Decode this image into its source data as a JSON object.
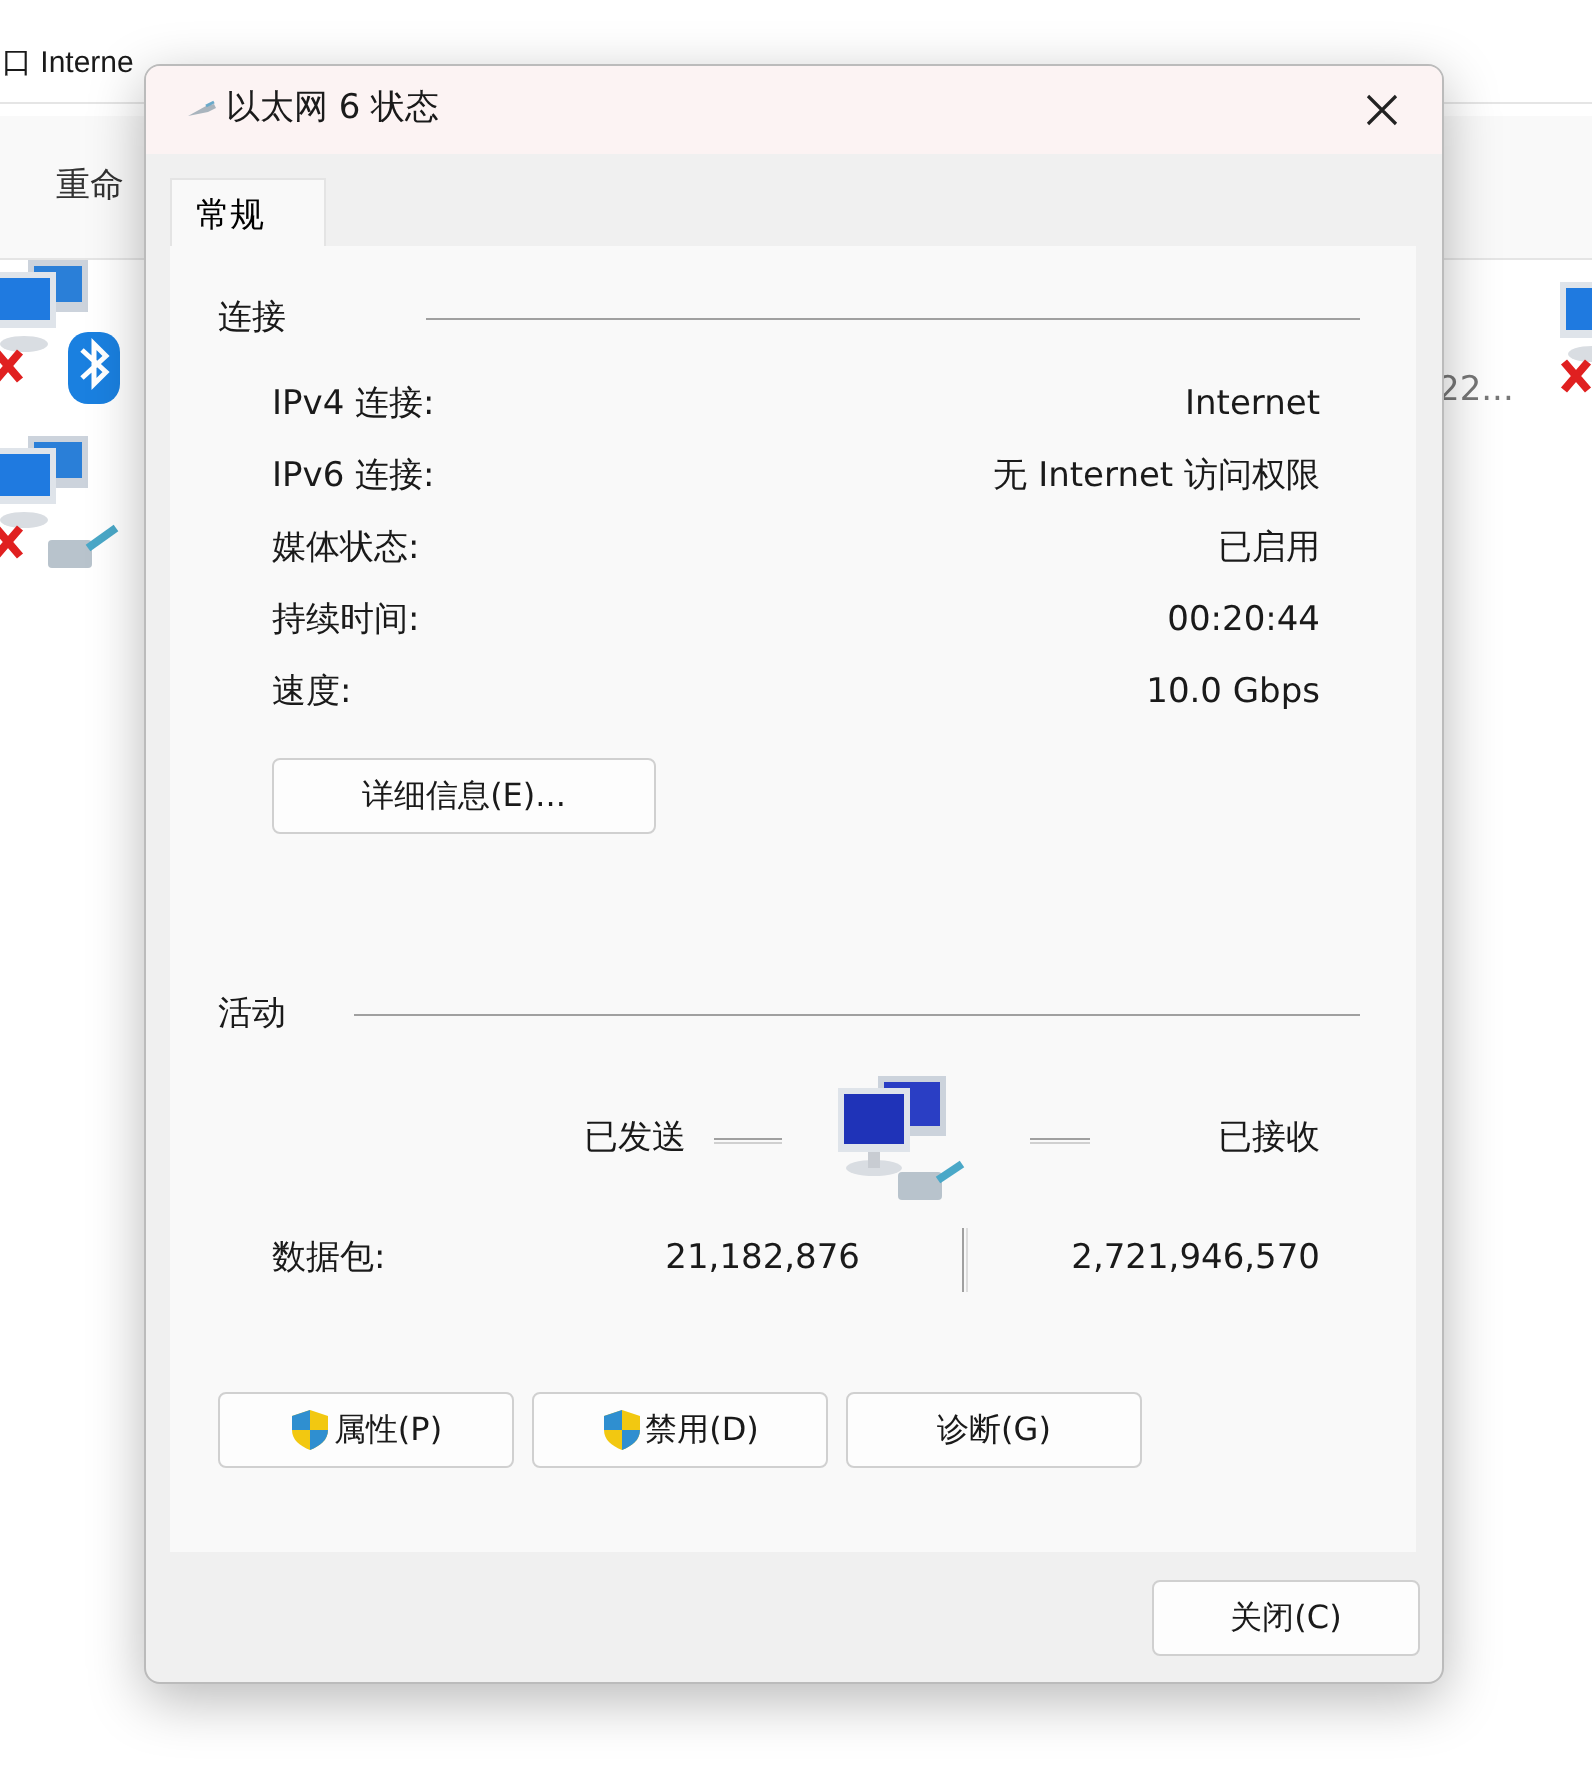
{
  "explorer": {
    "breadcrumb": [
      "口 Interne"
    ],
    "toolbar": [
      "重命"
    ],
    "adapters": [
      {
        "kind": "bluetooth",
        "disconnected": true
      },
      {
        "kind": "ethernet",
        "disconnected": true
      }
    ],
    "partial_label": "22...",
    "right_adapter": {
      "disconnected": true
    }
  },
  "dialog": {
    "title": "以太网 6 状态",
    "tabs": [
      {
        "label": "常规",
        "selected": true
      }
    ],
    "connection": {
      "heading": "连接",
      "rows": [
        {
          "label": "IPv4 连接:",
          "value": "Internet"
        },
        {
          "label": "IPv6 连接:",
          "value": "无 Internet 访问权限"
        },
        {
          "label": "媒体状态:",
          "value": "已启用"
        },
        {
          "label": "持续时间:",
          "value": "00:20:44"
        },
        {
          "label": "速度:",
          "value": "10.0 Gbps"
        }
      ],
      "details_button": "详细信息(E)..."
    },
    "activity": {
      "heading": "活动",
      "sent_label": "已发送",
      "received_label": "已接收",
      "packets": {
        "label": "数据包:",
        "sent": "21,182,876",
        "received": "2,721,946,570"
      }
    },
    "buttons": [
      {
        "label": "属性(P)",
        "shield": true
      },
      {
        "label": "禁用(D)",
        "shield": true
      },
      {
        "label": "诊断(G)",
        "shield": false
      }
    ],
    "close_button": "关闭(C)"
  }
}
